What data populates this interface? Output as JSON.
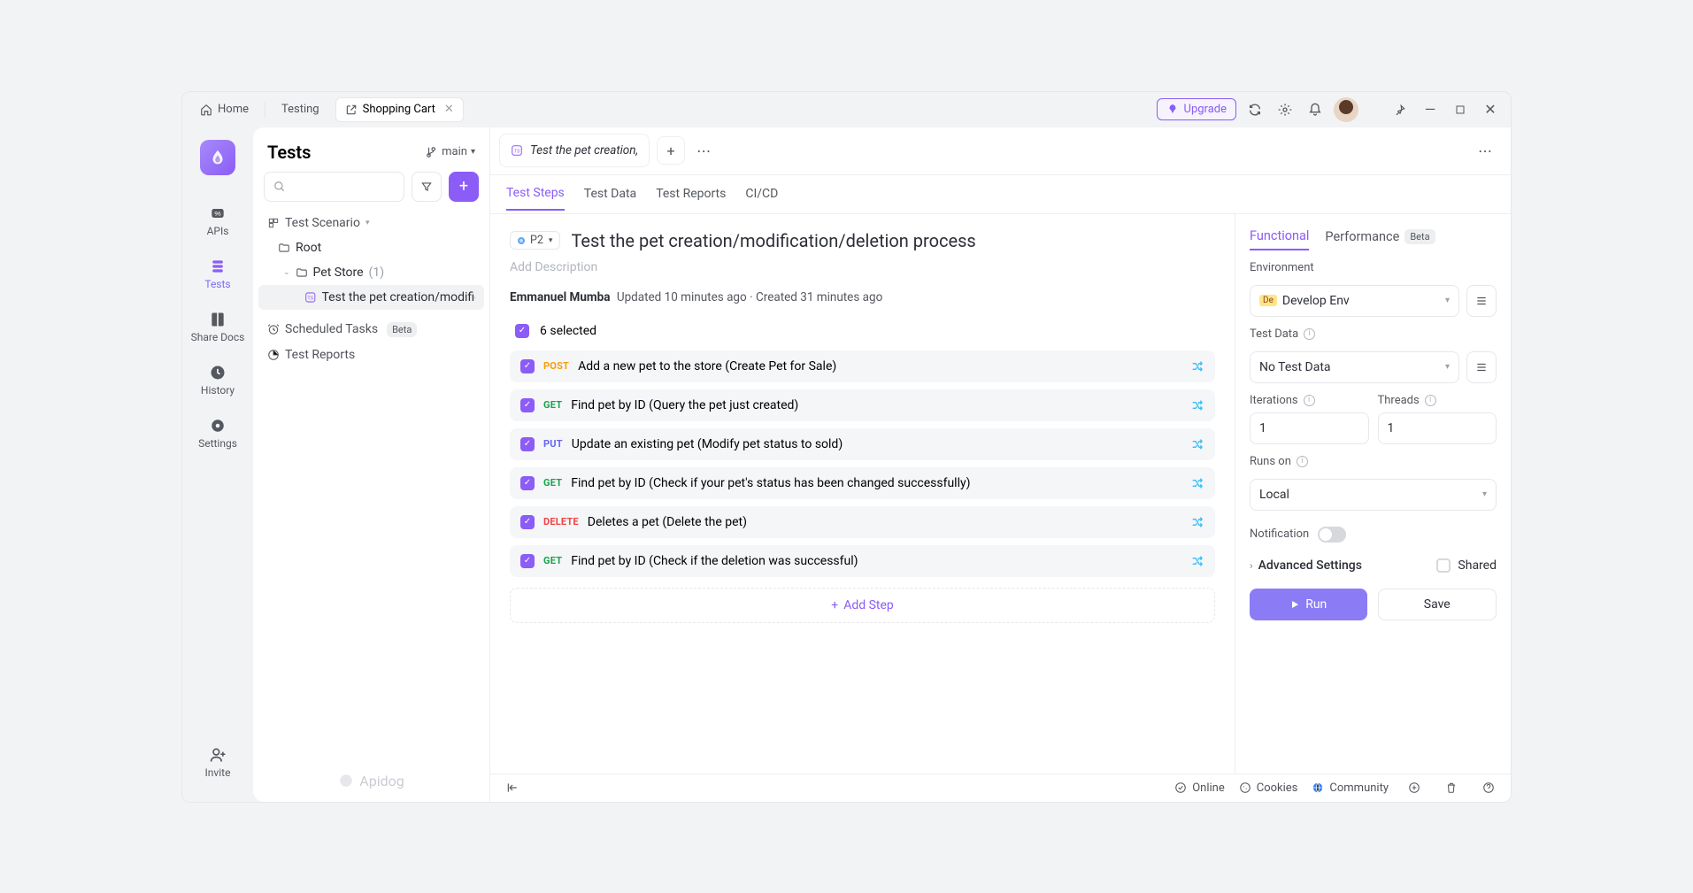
{
  "titlebar": {
    "home": "Home",
    "workspace": "Testing",
    "activeTab": "Shopping Cart",
    "upgrade": "Upgrade"
  },
  "leftbar": {
    "items": [
      {
        "label": "APIs"
      },
      {
        "label": "Tests"
      },
      {
        "label": "Share Docs"
      },
      {
        "label": "History"
      },
      {
        "label": "Settings"
      },
      {
        "label": "Invite"
      }
    ]
  },
  "sidebar": {
    "title": "Tests",
    "branch": "main",
    "scenarioHeader": "Test Scenario",
    "root": "Root",
    "folder": "Pet Store",
    "folderCount": "(1)",
    "testName": "Test the pet creation/modific",
    "scheduled": "Scheduled Tasks",
    "beta": "Beta",
    "reports": "Test Reports",
    "brand": "Apidog"
  },
  "doctab": {
    "title": "Test the pet creation,"
  },
  "subtabs": [
    "Test Steps",
    "Test Data",
    "Test Reports",
    "CI/CD"
  ],
  "header": {
    "priority": "P2",
    "title": "Test the pet creation/modification/deletion process",
    "descPlaceholder": "Add Description",
    "author": "Emmanuel Mumba",
    "updated": "Updated 10 minutes ago",
    "created": "Created 31 minutes ago"
  },
  "selection": "6 selected",
  "steps": [
    {
      "method": "POST",
      "text": "Add a new pet to the store (Create Pet for Sale)"
    },
    {
      "method": "GET",
      "text": "Find pet by ID (Query the pet just created)"
    },
    {
      "method": "PUT",
      "text": "Update an existing pet (Modify pet status to sold)"
    },
    {
      "method": "GET",
      "text": "Find pet by ID (Check if your pet's status has been changed successfully)"
    },
    {
      "method": "DELETE",
      "text": "Deletes a pet (Delete the pet)"
    },
    {
      "method": "GET",
      "text": "Find pet by ID (Check if the deletion was successful)"
    }
  ],
  "addStep": "Add Step",
  "rpanel": {
    "tabs": {
      "functional": "Functional",
      "performance": "Performance",
      "beta": "Beta"
    },
    "envLabel": "Environment",
    "envBadge": "De",
    "envValue": "Develop Env",
    "testDataLabel": "Test Data",
    "testDataValue": "No Test Data",
    "iterationsLabel": "Iterations",
    "iterationsValue": "1",
    "threadsLabel": "Threads",
    "threadsValue": "1",
    "runsOnLabel": "Runs on",
    "runsOnValue": "Local",
    "notificationLabel": "Notification",
    "advanced": "Advanced Settings",
    "shared": "Shared",
    "run": "Run",
    "save": "Save"
  },
  "statusbar": {
    "online": "Online",
    "cookies": "Cookies",
    "community": "Community"
  }
}
